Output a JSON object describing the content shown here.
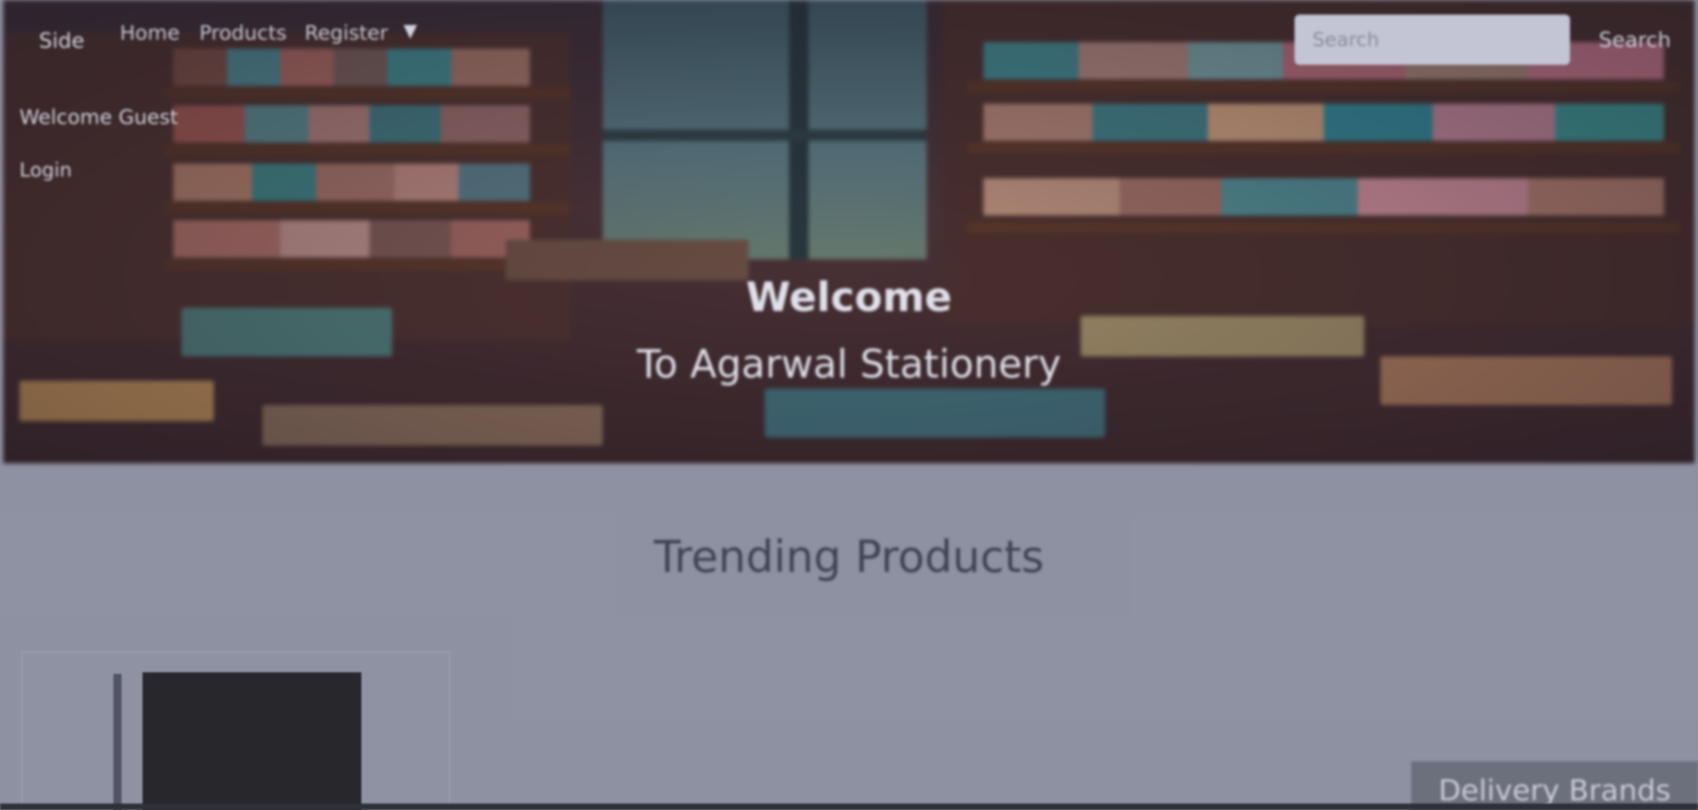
{
  "nav": {
    "brand": "Side",
    "links": {
      "home": "Home",
      "products": "Products",
      "register": "Register"
    },
    "search": {
      "placeholder": "Search",
      "button_label": "Search"
    }
  },
  "guest": {
    "welcome": "Welcome Guest",
    "login": "Login"
  },
  "hero": {
    "title": "Welcome",
    "subtitle": "To Agarwal Stationery"
  },
  "trending": {
    "heading": "Trending Products"
  },
  "delivery_brands": {
    "label": "Delivery Brands"
  },
  "colors": {
    "page_overlay": "#8f93a3",
    "heading_text": "#3d4150",
    "delivery_button": "#6c6f7b"
  }
}
